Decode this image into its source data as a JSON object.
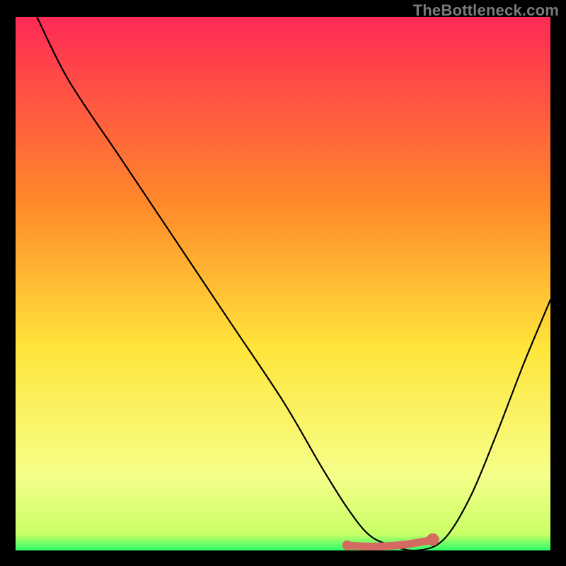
{
  "watermark": "TheBottleneck.com",
  "colors": {
    "page_bg": "#000000",
    "gradient_top": "#ff2a55",
    "gradient_mid1": "#ff8a2a",
    "gradient_mid2": "#ffe53b",
    "gradient_low": "#f6ff8a",
    "gradient_bottom": "#2bff66",
    "curve": "#000000",
    "marker": "#d46a62"
  },
  "chart_data": {
    "type": "line",
    "title": "",
    "xlabel": "",
    "ylabel": "",
    "xlim": [
      0,
      100
    ],
    "ylim": [
      0,
      100
    ],
    "series": [
      {
        "name": "bottleneck-curve",
        "x_pct": [
          4,
          10,
          20,
          30,
          40,
          50,
          57,
          62,
          66,
          70,
          75,
          80,
          85,
          90,
          95,
          100
        ],
        "y_bottleneck_pct": [
          100,
          88,
          73,
          58,
          43,
          28,
          16,
          8,
          3,
          1,
          0,
          2,
          10,
          22,
          35,
          47
        ]
      }
    ],
    "optimal_region": {
      "x_start_pct": 62,
      "x_end_pct": 78,
      "y_bottleneck_pct": 1.5
    },
    "annotations": []
  }
}
